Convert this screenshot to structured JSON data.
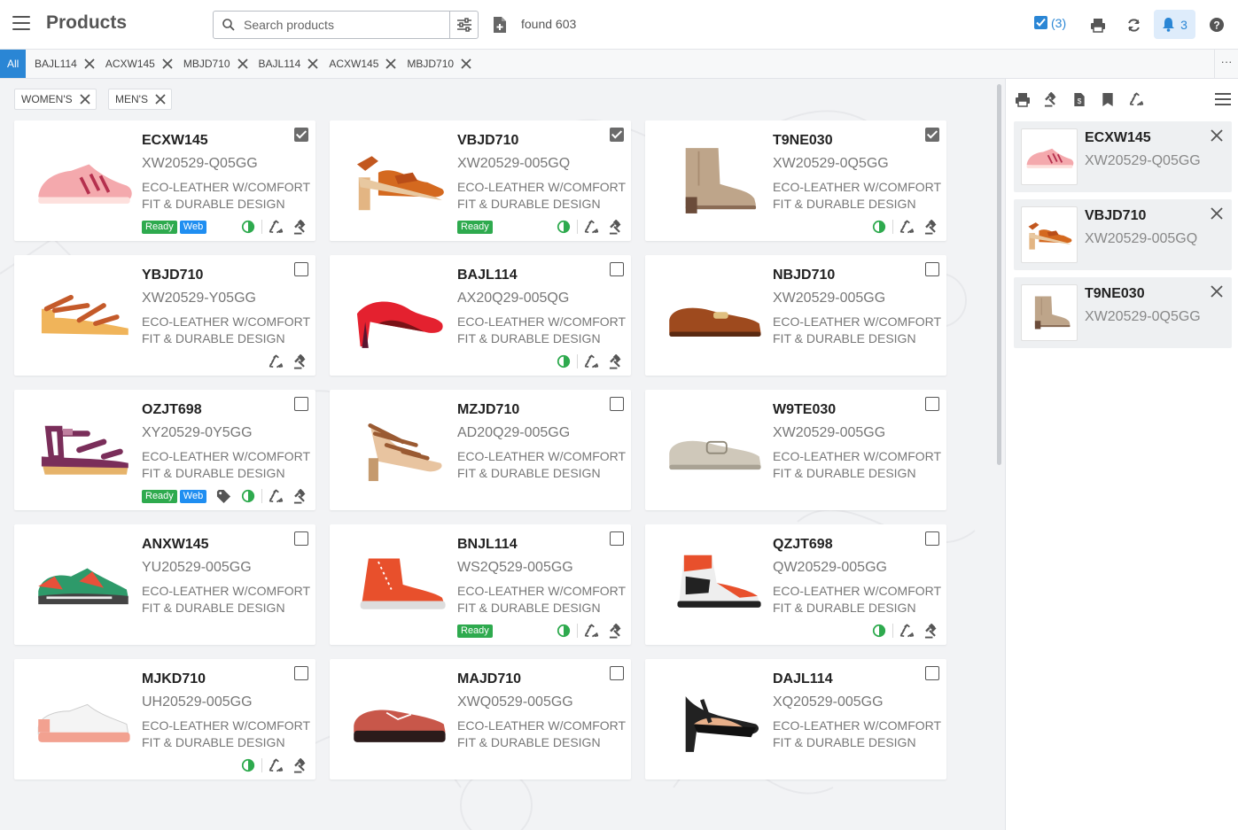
{
  "header": {
    "title": "Products",
    "search_placeholder": "Search products",
    "found": "found 603",
    "checked_count": "(3)",
    "notifications": "3",
    "accent": "#2a86d5"
  },
  "tabs": {
    "all_label": "All",
    "items": [
      "BAJL114",
      "ACXW145",
      "MBJD710",
      "BAJL114",
      "ACXW145",
      "MBJD710"
    ],
    "more": "···"
  },
  "filters": [
    "WOMEN'S",
    "MEN'S"
  ],
  "cards": [
    {
      "code": "ECXW145",
      "sku": "XW20529-Q05GG",
      "desc": "ECO-LEATHER W/COMFORT FIT & DURABLE DESIGN",
      "checked": true,
      "badges": [
        "Ready",
        "Web"
      ],
      "icons": [
        "eco-icon",
        "recycle-icon",
        "gavel-icon"
      ],
      "shoe": "sneaker-pink"
    },
    {
      "code": "VBJD710",
      "sku": "XW20529-005GQ",
      "desc": "ECO-LEATHER W/COMFORT FIT & DURABLE DESIGN",
      "checked": true,
      "badges": [
        "Ready"
      ],
      "icons": [
        "eco-icon",
        "recycle-icon",
        "gavel-icon"
      ],
      "shoe": "sandal-heel"
    },
    {
      "code": "T9NE030",
      "sku": "XW20529-0Q5GG",
      "desc": "ECO-LEATHER W/COMFORT FIT & DURABLE DESIGN",
      "checked": true,
      "badges": [],
      "icons": [
        "eco-icon",
        "recycle-icon",
        "gavel-icon"
      ],
      "shoe": "boot"
    },
    {
      "code": "YBJD710",
      "sku": "XW20529-Y05GG",
      "desc": "ECO-LEATHER W/COMFORT FIT & DURABLE DESIGN",
      "checked": false,
      "badges": [],
      "icons": [
        "recycle-icon",
        "gavel-icon"
      ],
      "shoe": "wedge-sandal"
    },
    {
      "code": "BAJL114",
      "sku": "AX20Q29-005QG",
      "desc": "ECO-LEATHER W/COMFORT FIT & DURABLE DESIGN",
      "checked": false,
      "badges": [],
      "icons": [
        "eco-icon",
        "recycle-icon",
        "gavel-icon"
      ],
      "shoe": "pump-red"
    },
    {
      "code": "NBJD710",
      "sku": "XW20529-005GG",
      "desc": "ECO-LEATHER W/COMFORT FIT & DURABLE DESIGN",
      "checked": false,
      "badges": [],
      "icons": [],
      "shoe": "loafer-brown"
    },
    {
      "code": "OZJT698",
      "sku": "XY20529-0Y5GG",
      "desc": "ECO-LEATHER W/COMFORT FIT & DURABLE DESIGN",
      "checked": false,
      "badges": [
        "Ready",
        "Web"
      ],
      "icons": [
        "tag-icon",
        "eco-icon",
        "recycle-icon",
        "gavel-icon"
      ],
      "shoe": "wedge-purple"
    },
    {
      "code": "MZJD710",
      "sku": "AD20Q29-005GG",
      "desc": "ECO-LEATHER W/COMFORT FIT & DURABLE DESIGN",
      "checked": false,
      "badges": [],
      "icons": [],
      "shoe": "strappy-heel"
    },
    {
      "code": "W9TE030",
      "sku": "XW20529-005GG",
      "desc": "ECO-LEATHER W/COMFORT FIT & DURABLE DESIGN",
      "checked": false,
      "badges": [],
      "icons": [],
      "shoe": "loafer-beige"
    },
    {
      "code": "ANXW145",
      "sku": "YU20529-005GG",
      "desc": "ECO-LEATHER W/COMFORT FIT & DURABLE DESIGN",
      "checked": false,
      "badges": [],
      "icons": [],
      "shoe": "runner-green"
    },
    {
      "code": "BNJL114",
      "sku": "WS2Q529-005GG",
      "desc": "ECO-LEATHER W/COMFORT FIT & DURABLE DESIGN",
      "checked": false,
      "badges": [
        "Ready"
      ],
      "icons": [
        "eco-icon",
        "recycle-icon",
        "gavel-icon"
      ],
      "shoe": "hightop-orange"
    },
    {
      "code": "QZJT698",
      "sku": "QW20529-005GG",
      "desc": "ECO-LEATHER W/COMFORT FIT & DURABLE DESIGN",
      "checked": false,
      "badges": [],
      "icons": [
        "eco-icon",
        "recycle-icon",
        "gavel-icon"
      ],
      "shoe": "hightop-black"
    },
    {
      "code": "MJKD710",
      "sku": "UH20529-005GG",
      "desc": "ECO-LEATHER W/COMFORT FIT & DURABLE DESIGN",
      "checked": false,
      "badges": [],
      "icons": [
        "eco-icon",
        "recycle-icon",
        "gavel-icon"
      ],
      "shoe": "sneaker-white"
    },
    {
      "code": "MAJD710",
      "sku": "XWQ0529-005GG",
      "desc": "ECO-LEATHER W/COMFORT FIT & DURABLE DESIGN",
      "checked": false,
      "badges": [],
      "icons": [],
      "shoe": "derby-red"
    },
    {
      "code": "DAJL114",
      "sku": "XQ20529-005GG",
      "desc": "ECO-LEATHER W/COMFORT FIT & DURABLE DESIGN",
      "checked": false,
      "badges": [],
      "icons": [],
      "shoe": "tstrap-black"
    }
  ],
  "panel": {
    "tools": [
      "print-icon",
      "gavel-icon",
      "doc-icon",
      "bookmark-icon",
      "recycle-icon"
    ],
    "items": [
      {
        "code": "ECXW145",
        "sku": "XW20529-Q05GG",
        "shoe": "sneaker-pink"
      },
      {
        "code": "VBJD710",
        "sku": "XW20529-005GQ",
        "shoe": "sandal-heel"
      },
      {
        "code": "T9NE030",
        "sku": "XW20529-0Q5GG",
        "shoe": "boot"
      }
    ]
  }
}
